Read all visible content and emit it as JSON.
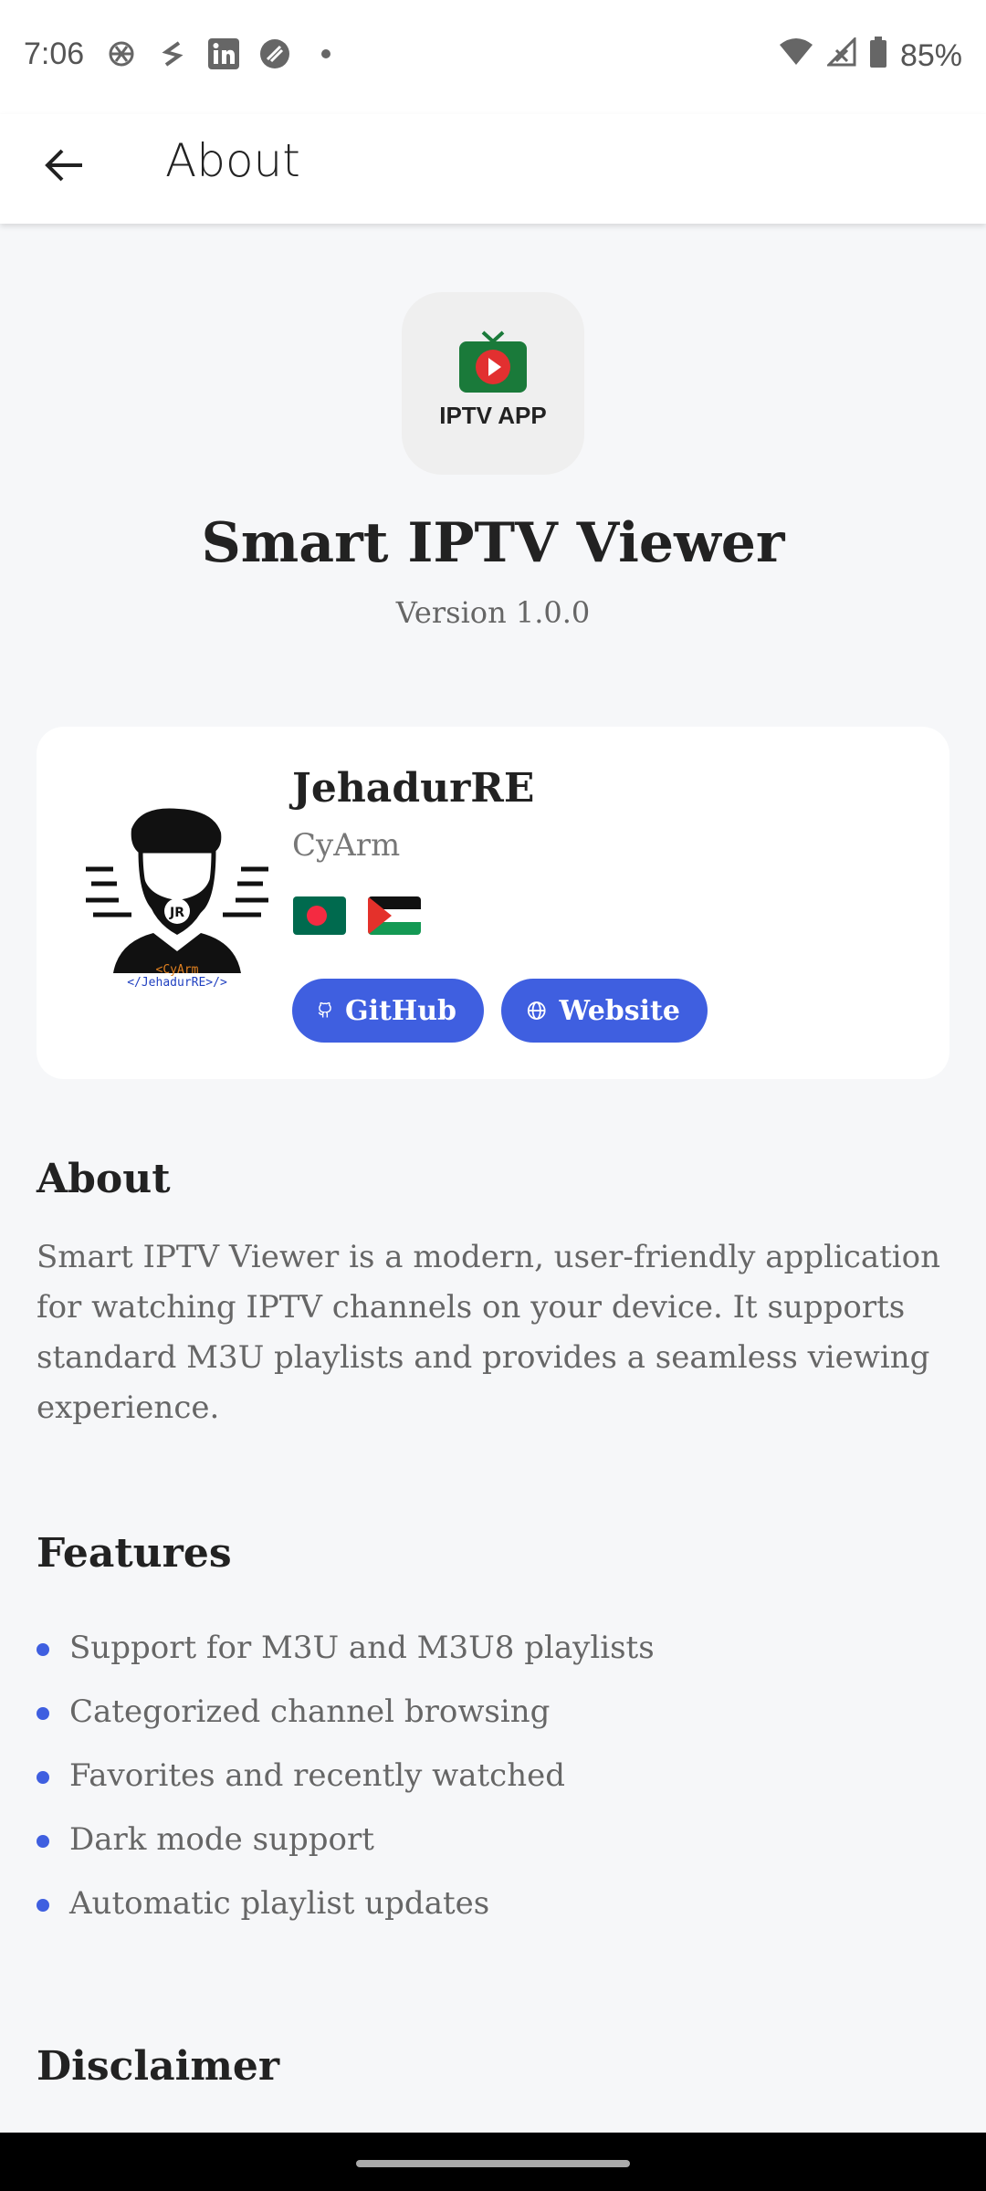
{
  "status_bar": {
    "time": "7:06",
    "battery": "85%",
    "notification_icons": [
      "openai-icon",
      "stack-icon",
      "linkedin-icon",
      "chat-icon",
      "dot-icon"
    ]
  },
  "app_bar": {
    "title": "About"
  },
  "app": {
    "icon_label": "IPTV APP",
    "name": "Smart IPTV Viewer",
    "version": "Version 1.0.0"
  },
  "developer": {
    "name": "JehadurRE",
    "org": "CyArm",
    "avatar_text_top": "<CyArm",
    "avatar_text_bottom": "</JehadurRE>/>",
    "flags": [
      "bangladesh-flag",
      "palestine-flag"
    ],
    "github_label": "GitHub",
    "website_label": "Website"
  },
  "about": {
    "heading": "About",
    "text": "Smart IPTV Viewer is a modern, user-friendly application for watching IPTV channels on your device. It supports standard M3U playlists and provides a seamless viewing experience."
  },
  "features": {
    "heading": "Features",
    "items": [
      "Support for M3U and M3U8 playlists",
      "Categorized channel browsing",
      "Favorites and recently watched",
      "Dark mode support",
      "Automatic playlist updates"
    ]
  },
  "disclaimer": {
    "heading": "Disclaimer"
  },
  "colors": {
    "accent": "#3f5fe0",
    "background": "#f6f7f9",
    "card": "#ffffff"
  }
}
